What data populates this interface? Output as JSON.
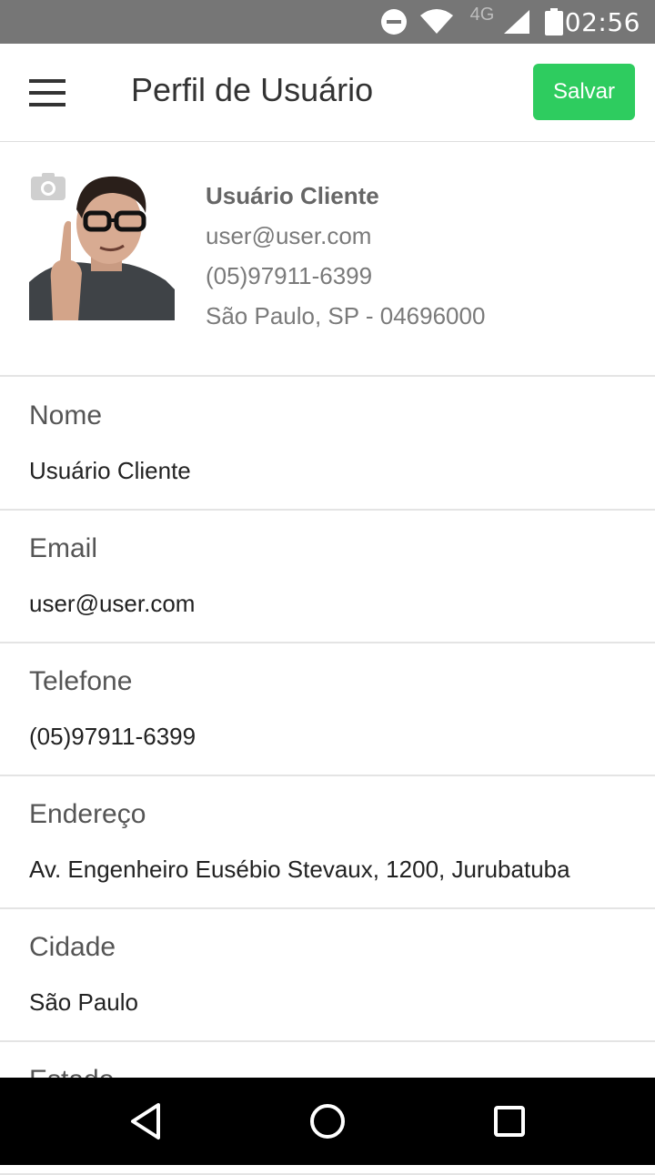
{
  "status_bar": {
    "network": "4G",
    "time": "02:56",
    "icons": [
      "do-not-disturb-icon",
      "wifi-icon",
      "signal-icon",
      "battery-icon"
    ]
  },
  "header": {
    "title": "Perfil de Usuário",
    "save_label": "Salvar",
    "accent": "#2ecc5f"
  },
  "profile": {
    "name": "Usuário Cliente",
    "email": "user@user.com",
    "phone": "(05)97911-6399",
    "location": "São Paulo, SP - 04696000"
  },
  "fields": [
    {
      "label": "Nome",
      "value": "Usuário Cliente"
    },
    {
      "label": "Email",
      "value": "user@user.com"
    },
    {
      "label": "Telefone",
      "value": "(05)97911-6399"
    },
    {
      "label": "Endereço",
      "value": "Av. Engenheiro Eusébio Stevaux, 1200, Jurubatuba"
    },
    {
      "label": "Cidade",
      "value": "São Paulo"
    },
    {
      "label": "Estado",
      "value": ""
    }
  ],
  "nav": [
    "back-icon",
    "home-icon",
    "recents-icon"
  ]
}
